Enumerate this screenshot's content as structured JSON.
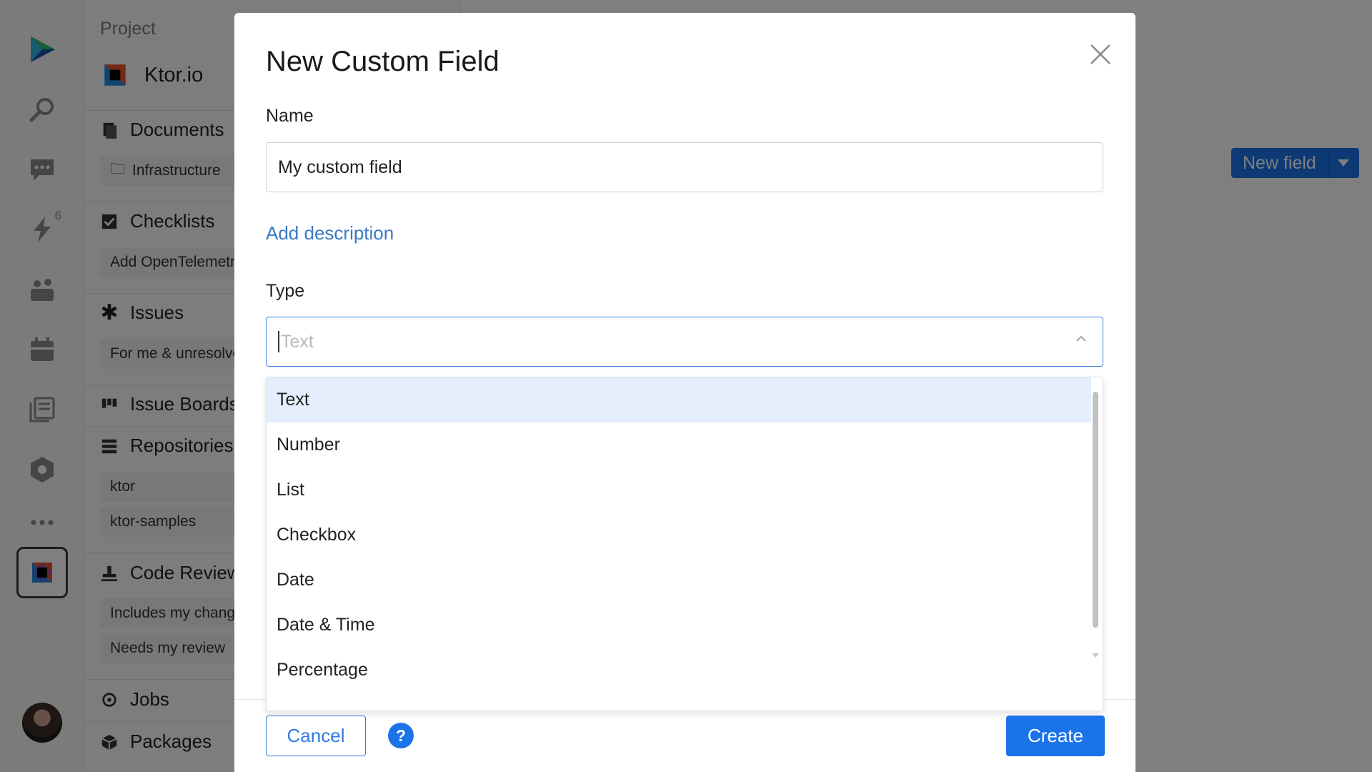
{
  "sidebar": {
    "project_label": "Project",
    "project_name": "Ktor.io",
    "sections": {
      "documents": {
        "title": "Documents",
        "sub": "Infrastructure"
      },
      "checklists": {
        "title": "Checklists",
        "sub": "Add OpenTelemetry"
      },
      "issues": {
        "title": "Issues",
        "sub": "For me & unresolved"
      },
      "boards": {
        "title": "Issue Boards"
      },
      "repositories": {
        "title": "Repositories",
        "items": [
          "ktor",
          "ktor-samples"
        ]
      },
      "reviews": {
        "title": "Code Reviews",
        "items": [
          "Includes my changes",
          "Needs my review"
        ]
      },
      "jobs": {
        "title": "Jobs"
      },
      "packages": {
        "title": "Packages"
      }
    },
    "rail_badge": "6"
  },
  "toolbar": {
    "new_field_label": "New field"
  },
  "modal": {
    "title": "New Custom Field",
    "name_label": "Name",
    "name_value": "My custom field",
    "add_description": "Add description",
    "type_label": "Type",
    "type_placeholder": "Text",
    "options": [
      "Text",
      "Number",
      "List",
      "Checkbox",
      "Date",
      "Date & Time",
      "Percentage"
    ],
    "cancel_label": "Cancel",
    "help_label": "?",
    "create_label": "Create"
  },
  "colors": {
    "accent": "#1a73e8",
    "selected_option": "#e4eefc",
    "overlay": "rgba(0,0,0,0.5)"
  }
}
